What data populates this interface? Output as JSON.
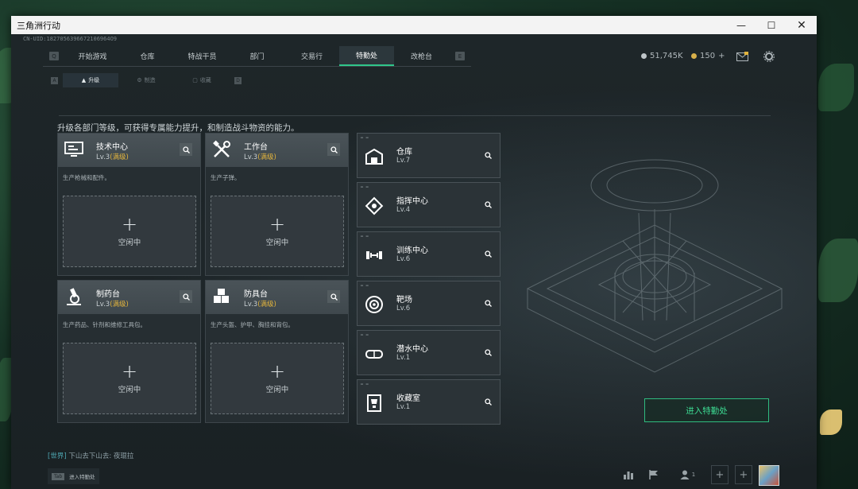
{
  "window": {
    "title": "三角洲行动"
  },
  "uid": "CN-UID:1827056396672106964O9",
  "topnav": {
    "left_key": "Q",
    "right_key": "E",
    "tabs": [
      {
        "label": "开始游戏",
        "active": false
      },
      {
        "label": "仓库",
        "active": false
      },
      {
        "label": "特战干员",
        "active": false
      },
      {
        "label": "部门",
        "active": false
      },
      {
        "label": "交易行",
        "active": false
      },
      {
        "label": "特勤处",
        "active": true
      },
      {
        "label": "改枪台",
        "active": false
      }
    ]
  },
  "currency": {
    "primary": "51,745K",
    "secondary": "150",
    "add": "+"
  },
  "subnav": {
    "left_key": "A",
    "right_key": "D",
    "tabs": [
      {
        "label": "升级",
        "active": true
      },
      {
        "label": "制造",
        "active": false
      },
      {
        "label": "收藏",
        "active": false
      }
    ]
  },
  "description": "升级各部门等级，可获得专属能力提升，和制造战斗物资的能力。",
  "cards": [
    {
      "name": "技术中心",
      "level": "Lv.3",
      "max": "(满级)",
      "desc": "生产枪械和配件。",
      "idle": "空闲中",
      "icon": "computer-icon"
    },
    {
      "name": "工作台",
      "level": "Lv.3",
      "max": "(满级)",
      "desc": "生产子弹。",
      "idle": "空闲中",
      "icon": "tools-icon"
    },
    {
      "name": "制药台",
      "level": "Lv.3",
      "max": "(满级)",
      "desc": "生产药品、针剂和维修工具包。",
      "idle": "空闲中",
      "icon": "microscope-icon"
    },
    {
      "name": "防具台",
      "level": "Lv.3",
      "max": "(满级)",
      "desc": "生产头盔、护甲、胸挂和背包。",
      "idle": "空闲中",
      "icon": "armor-icon"
    }
  ],
  "facilities": [
    {
      "name": "仓库",
      "level": "Lv.7",
      "icon": "warehouse-icon"
    },
    {
      "name": "指挥中心",
      "level": "Lv.4",
      "icon": "command-icon"
    },
    {
      "name": "训练中心",
      "level": "Lv.6",
      "icon": "dumbbell-icon"
    },
    {
      "name": "靶场",
      "level": "Lv.6",
      "icon": "target-icon"
    },
    {
      "name": "潜水中心",
      "level": "Lv.1",
      "icon": "diving-mask-icon"
    },
    {
      "name": "收藏室",
      "level": "Lv.1",
      "icon": "trophy-icon"
    }
  ],
  "enter_button": "进入特勤处",
  "chat": {
    "channel": "[世界]",
    "message": "下山去下山去: 夜琨拉"
  },
  "tab_hint": {
    "key": "Tab",
    "label": "进入特勤处"
  },
  "bottom": {
    "friends_count": "1"
  },
  "colors": {
    "accent": "#30c68a",
    "max_level": "#e2b43d",
    "channel": "#4ea7b2"
  }
}
